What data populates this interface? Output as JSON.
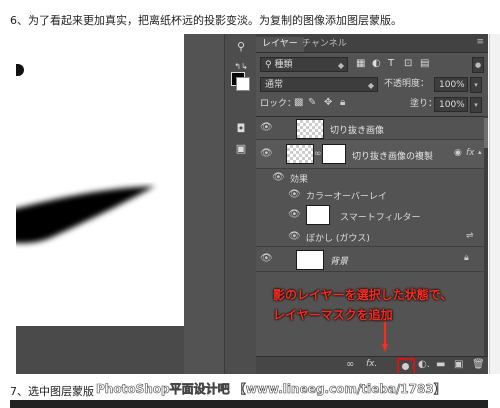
{
  "article": {
    "step6": "6、为了看起来更加真实，把离纸杯远的投影变淡。为复制的图像添加图层蒙版。",
    "step7": "7、选中图层蒙版",
    "watermark": "PhotoShop平面设计吧 【www.lineeg.com/tieba/1783】"
  },
  "panel": {
    "tabs": [
      "レイヤー",
      "チャンネル"
    ],
    "filter_kind": "種類",
    "blend_mode": "通常",
    "opacity_label": "不透明度：",
    "opacity_value": "100%",
    "lock_label": "ロック：",
    "fill_label": "塗り：",
    "fill_value": "100%"
  },
  "layers": [
    {
      "name": "切り抜き画像",
      "type": "pixel"
    },
    {
      "name": "切り抜き画像の複製",
      "type": "smart",
      "selected": true,
      "fx": "fx"
    },
    {
      "name": "効果",
      "type": "sub"
    },
    {
      "name": "カラーオーバーレイ",
      "type": "sub"
    },
    {
      "name": "スマートフィルター",
      "type": "sub"
    },
    {
      "name": "ぼかし (ガウス)",
      "type": "sub"
    },
    {
      "name": "背景",
      "type": "background"
    }
  ],
  "annotation": {
    "line1": "影のレイヤーを選択した状態で、",
    "line2": "レイヤーマスクを追加"
  },
  "colors": {
    "annotation": "#ff2a1a",
    "panel_bg": "#535353",
    "highlight_box": "#e01010"
  },
  "icons": {
    "link": "link-icon",
    "fx": "fx-icon",
    "mask": "add-layer-mask-icon",
    "adjust": "adjustment-icon",
    "group": "folder-icon",
    "new": "new-layer-icon",
    "trash": "trash-icon"
  }
}
